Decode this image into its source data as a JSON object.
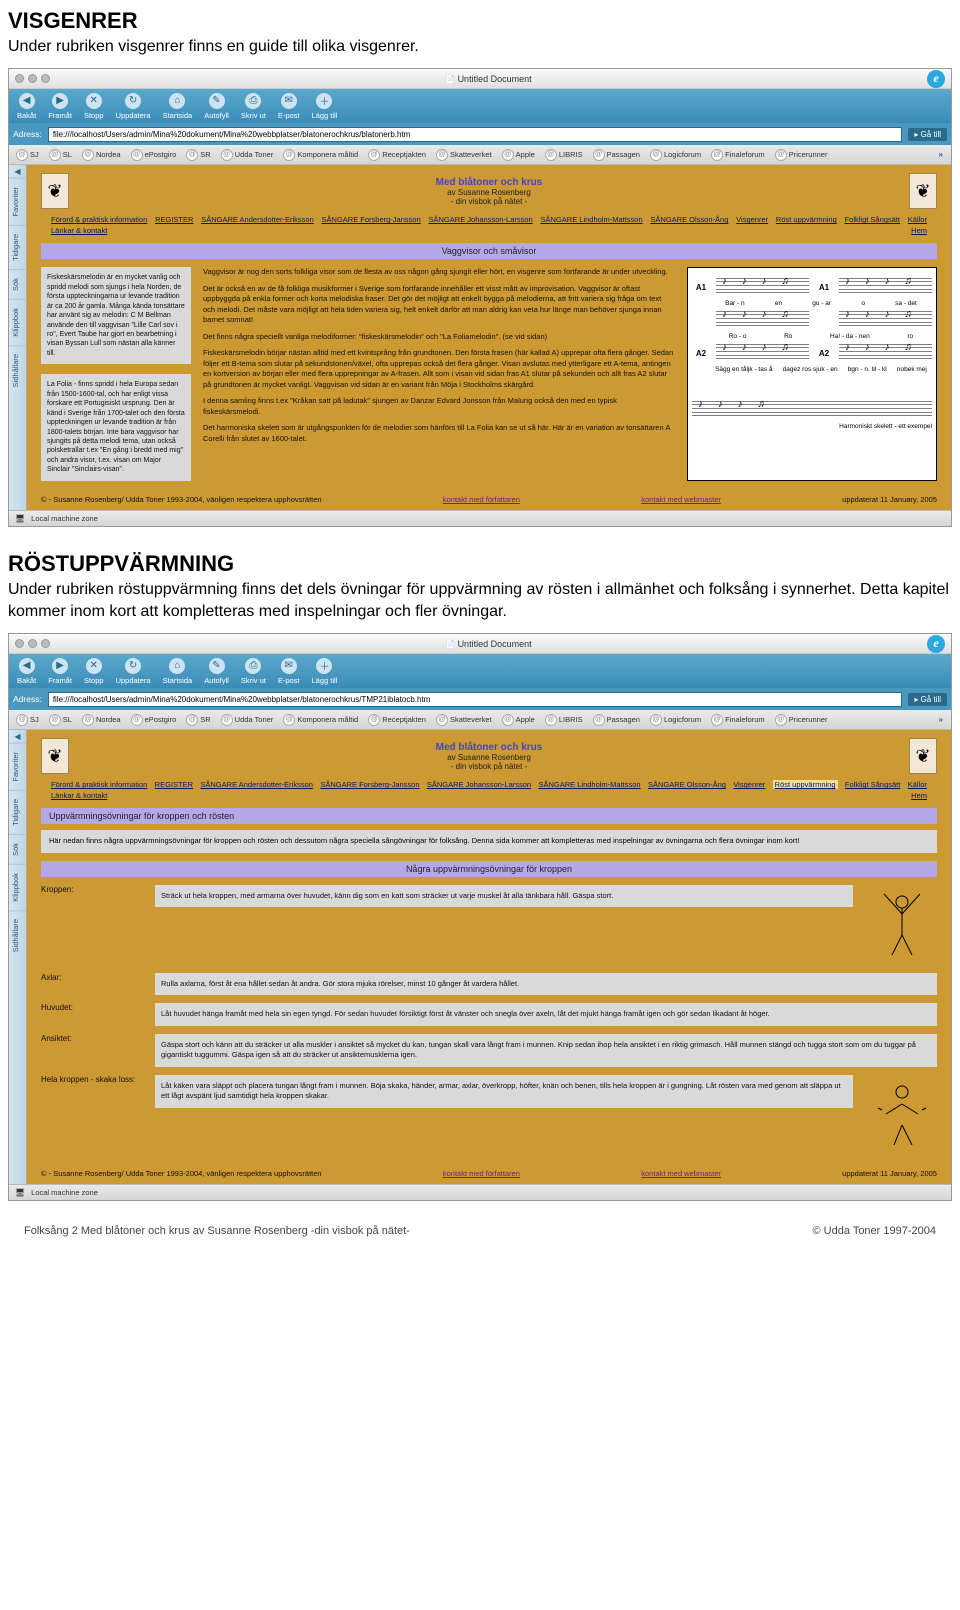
{
  "sec1": {
    "title": "VISGENRER",
    "desc": "Under rubriken visgenrer finns en guide till olika visgenrer."
  },
  "sec2": {
    "title": "RÖSTUPPVÄRMNING",
    "desc": "Under rubriken röstuppvärmning finns det dels övningar för uppvärmning av rösten i allmänhet och folksång i synnerhet. Detta kapitel kommer inom kort att kompletteras med inspelningar och fler övningar."
  },
  "browser": {
    "title": "Untitled Document",
    "ie": "e",
    "tb": {
      "back": "Bakåt",
      "fwd": "Framåt",
      "stop": "Stopp",
      "refresh": "Uppdatera",
      "home": "Startsida",
      "autofill": "Autofyll",
      "print": "Skriv ut",
      "mail": "E-post",
      "add": "Lägg till"
    },
    "addrLabel": "Adress:",
    "go": "▸ Gå till",
    "url1": "file:///localhost/Users/admin/Mina%20dokument/Mina%20webbplatser/blatonerochkrus/blatonerb.htm",
    "url2": "file:///localhost/Users/admin/Mina%20dokument/Mina%20webbplatser/blatonerochkrus/TMP21iblatocb.htm",
    "bookmarks": [
      "SJ",
      "SL",
      "Nordea",
      "ePostgiro",
      "SR",
      "Udda Toner",
      "Komponera måltid",
      "Receptjakten",
      "Skatteverket",
      "Apple",
      "LIBRIS",
      "Passagen",
      "Logicforum",
      "Finaleforum",
      "Pricerunner"
    ],
    "more": "»",
    "sidetabs": [
      "Favoriter",
      "Tidigare",
      "Sök",
      "Klippbok",
      "Sidhållare"
    ],
    "status": "Local machine zone"
  },
  "site": {
    "h1": "Med blåtoner och krus",
    "h2": "av Susanne Rosenberg",
    "h3": "- din visbok på nätet -",
    "logo": "❦",
    "nav": [
      "Förord & praktisk information",
      "REGISTER",
      "SÅNGARE Andersdotter-Eriksson",
      "SÅNGARE Forsberg-Jansson",
      "SÅNGARE Johansson-Larsson",
      "SÅNGARE Lindholm-Mattsson",
      "SÅNGARE Olsson-Ång",
      "Visgenrer",
      "Röst uppvärmning",
      "Folkligt Sångsätt",
      "Källor",
      "Länkar & kontakt",
      "Hem"
    ]
  },
  "p1": {
    "bar": "Vaggvisor och småvisor",
    "box1": "Fiskeskärsmelodin  är en mycket vanlig och spridd melodi som sjungs i hela Norden, de första uppteckningarna ur levande tradition är ca 200 år gamla. Många kända tonsättare har använt sig av melodin: C M Bellman använde den till vaggvisan \"Lille Carl sov i ro\", Evert Taube har gjort en bearbetning i visan Byssan Lull som nästan alla känner till.",
    "box2": "La Folia - finns spridd i hela Europa sedan från 1500-1600-tal, och har enligt vissa forskare ett Portugisiskt ursprung. Den är känd i Sverige från 1700-talet och den första uppteckningen ur levande tradition är från 1800-talets början. Inte bara vaggvisor har sjungits på detta melodi tema, utan också polsketrallar t.ex \"En gång i bredd med mig\" och andra visor, t.ex. visan om Major Sinclair \"Sinclairs-visan\".",
    "mid": [
      "Vaggvisor är nog den sorts folkliga visor som de flesta av oss någon gång sjungit eller hört, en visgenre som fortfarande är under utveckling.",
      "Det är också en av de få folkliga musikformer i Sverige som fortfarande innehåller ett visst mått av improvisation. Vaggvisor är oftast uppbyggda på enkla former och korta melodiska fraser. Det gör det möjligt att enkelt bygga på melodierna, att fritt variera sig fråga om text och melodi. Det måste vara möjligt att hela tiden variera sig, helt enkelt därför att man aldrig kan veta hur länge man behöver sjunga innan barnet somnat!",
      "Det finns några speciellt vanliga melodiformer: \"fiskeskärsmelodin\" och \"La Foliamelodin\". (se vid sidan)",
      "Fiskeskärsmelodin börjar nästan alltid med ett kvintsprång från grundtonen. Den första frasen (här kallad A) upprepar ofta flera gånger. Sedan följer ett B-tema som slutar på sekundstonen/växel, ofta  upprepas också det flera gånger. Visan avslutas  med ytterligare ett A-tema, antingen en kortversion av början eller med flera upprepningar av A-frasen. Allt som i visan vid sidan fras A1 slutar på sekunden och allt fras A2 slutar på grundtonen är mycket vanligt. Vaggvisan vid sidan är en variant från Möja i Stockholms skärgård.",
      "I denna samling finns t.ex \"Kråkan satt på ladutak\" sjungen av Danzar Edvard Jonsson från Malung också den med en typisk fiskeskärsmelodi.",
      "Det harmoniska skelett som är utgångspunkten för de melodier som hänförs till La Folia kan se ut så här. Här är en variation av tonsättaren A Corelli från slutet av 1600-talet."
    ],
    "chords": [
      "A1",
      "A1",
      "A2",
      "A2"
    ],
    "lyr1": [
      "Bar - n",
      "en",
      "gu - ar",
      "o",
      "sa - det"
    ],
    "lyr2": [
      "Ro - o",
      "Ro",
      "Ha! - da - nen",
      "ro"
    ],
    "lyr3": [
      "Sägg en tåljk - tas å",
      "dagez ros sjuk - en",
      "bgn - n. til - kl",
      "nobek mej"
    ],
    "cap": "Harmoniskt skelett - ett exempel"
  },
  "p2": {
    "bar1": "Uppvärmningsövningar för kroppen och rösten",
    "intro": "Här nedan finns några uppvärmningsövningar för kroppen och rösten och dessutom några speciella sångövningar för folksång. Denna sida kommer att kompletteras med inspelningar av övningarna och flera övningar inom kort!",
    "bar2": "Några uppvärmningsövningar för kroppen",
    "ex": [
      {
        "label": "Kroppen:",
        "text": "Sträck ut hela kroppen, med armarna över huvudet, känn dig som en katt som sträcker ut varje muskel åt alla tänkbara håll. Gäspa stort."
      },
      {
        "label": "Axlar:",
        "text": "Rulla axlarna, först åt ena hållet sedan åt andra. Gör stora mjuka rörelser, minst 10 gånger åt vardera hållet."
      },
      {
        "label": "Huvudet:",
        "text": "Låt huvudet hänga framåt med hela sin egen tyngd. För sedan huvudet försiktigt först åt vänster och snegla över axeln, låt det mjukt hänga framåt igen och gör sedan likadant åt höger."
      },
      {
        "label": "Ansiktet:",
        "text": "Gäspa stort och känn att du sträcker ut alla muskler i ansiktet så mycket du kan, tungan skall vara långt fram i munnen. Knip sedan ihop hela ansiktet i en riktig grimasch. Håll munnen stängd och tugga stort som om du tuggar på gigantiskt tuggummi. Gäspa igen så att du sträcker ut ansiktemusklerna igen."
      },
      {
        "label": "Hela kroppen - skaka loss:",
        "text": "Låt käken vara släppt och placera tungan långt fram i munnen. Böja skaka, händer, armar, axlar, överkropp, höfter, knän och benen, tills hela kroppen är i gungning. Låt rösten vara med genom att släppa ut ett lågt avspänt ljud samtidigt hela kroppen skakar."
      }
    ]
  },
  "footer": {
    "copy": "© - Susanne Rosenberg/ Udda Toner 1993-2004, vänligen respektera upphovsrätten",
    "link1": "kontakt med författaren",
    "link2": "kontakt med webmaster",
    "date": "uppdaterat 11 January, 2005"
  },
  "pagefoot": {
    "left": "Folksång 2   Med blåtoner och krus av Susanne Rosenberg   -din visbok på nätet-",
    "right": "© Udda Toner 1997-2004"
  }
}
